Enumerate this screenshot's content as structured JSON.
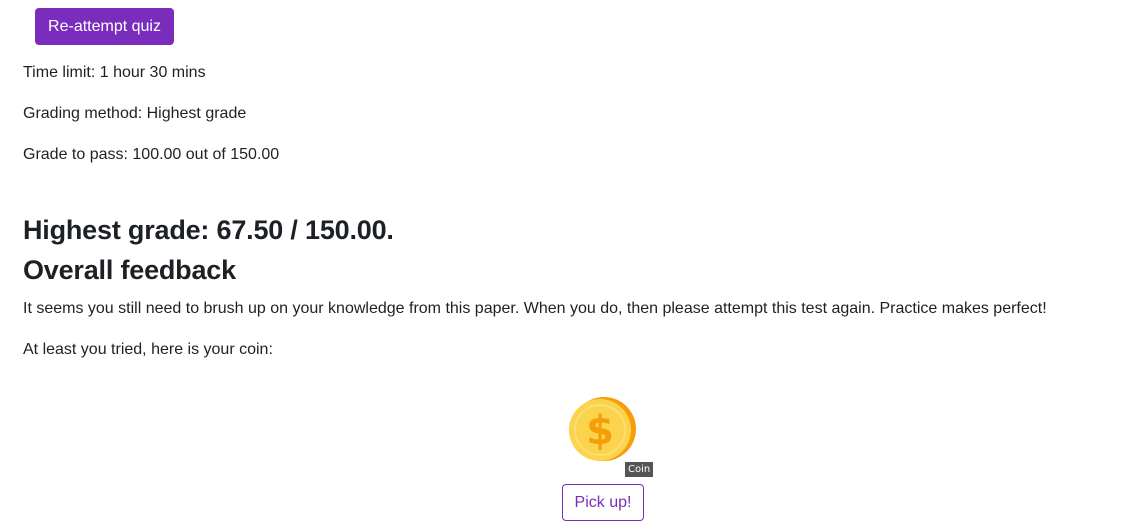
{
  "actions": {
    "reattempt_label": "Re-attempt quiz"
  },
  "quiz_info": {
    "time_limit": "Time limit: 1 hour 30 mins",
    "grading_method": "Grading method: Highest grade",
    "grade_to_pass": "Grade to pass: 100.00 out of 150.00"
  },
  "results": {
    "highest_grade": "Highest grade: 67.50 / 150.00.",
    "feedback_heading": "Overall feedback",
    "feedback_text": "It seems you still need to brush up on your knowledge from this paper. When you do, then please attempt this test again. Practice makes perfect!",
    "coin_message": "At least you tried, here is your coin:"
  },
  "coin": {
    "icon": "dollar-coin-icon",
    "tooltip": "Coin",
    "pickup_label": "Pick up!"
  },
  "colors": {
    "accent": "#7a2dbd",
    "text": "#1d2125",
    "coin_face": "#fcd34d",
    "coin_edge": "#f59e0b",
    "tooltip_bg": "#555555"
  }
}
